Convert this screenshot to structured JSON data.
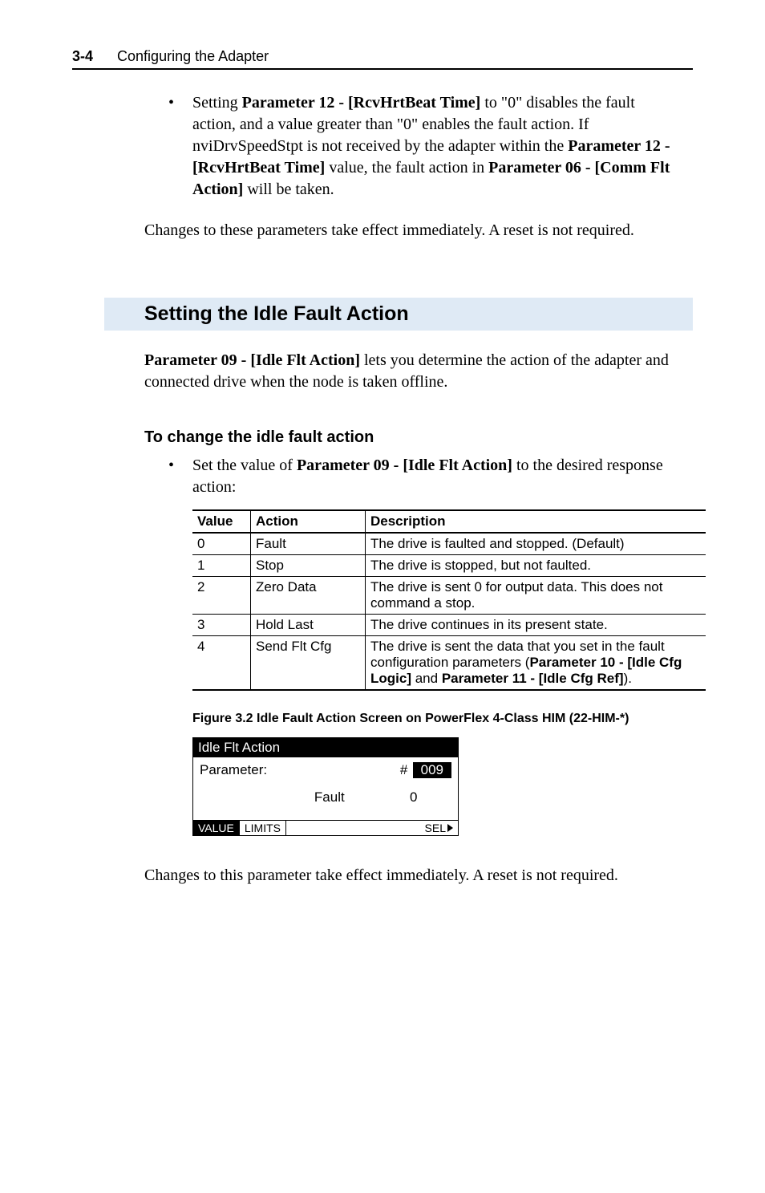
{
  "header": {
    "page": "3-4",
    "title": "Configuring the Adapter"
  },
  "bullet1": {
    "t1": "Setting ",
    "b1": "Parameter 12 - [RcvHrtBeat Time]",
    "t2": " to \"0\" disables the fault action, and a value greater than \"0\" enables the fault action. If nviDrvSpeedStpt is not received by the adapter within the ",
    "b2": "Parameter 12 - [RcvHrtBeat Time]",
    "t3": " value, the fault action in ",
    "b3": "Parameter 06 - [Comm Flt Action]",
    "t4": " will be taken."
  },
  "para_after_bullet": "Changes to these parameters take effect immediately. A reset is not required.",
  "section_heading": "Setting the Idle Fault Action",
  "section_para": {
    "b1": "Parameter 09 - [Idle Flt Action]",
    "t1": " lets you determine the action of the adapter and connected drive when the node is taken offline."
  },
  "sub_heading": "To change the idle fault action",
  "bullet2": {
    "t1": "Set the value of ",
    "b1": "Parameter 09 - [Idle Flt Action]",
    "t2": " to the desired response action:"
  },
  "table": {
    "headers": {
      "value": "Value",
      "action": "Action",
      "desc": "Description"
    },
    "rows": [
      {
        "value": "0",
        "action": "Fault",
        "desc_plain": "The drive is faulted and stopped. (Default)"
      },
      {
        "value": "1",
        "action": "Stop",
        "desc_plain": "The drive is stopped, but not faulted."
      },
      {
        "value": "2",
        "action": "Zero Data",
        "desc_plain": "The drive is sent 0 for output data. This does not command a stop."
      },
      {
        "value": "3",
        "action": "Hold Last",
        "desc_plain": "The drive continues in its present state."
      },
      {
        "value": "4",
        "action": "Send Flt Cfg",
        "desc_t1": "The drive is sent the data that you set in the fault configuration parameters (",
        "desc_b1": "Parameter 10 - [Idle Cfg Logic]",
        "desc_t2": " and ",
        "desc_b2": "Parameter 11 - [Idle Cfg Ref]",
        "desc_t3": ")."
      }
    ]
  },
  "figure_caption": "Figure 3.2   Idle Fault Action Screen on PowerFlex 4-Class HIM (22-HIM-*)",
  "him": {
    "title": "Idle Flt Action",
    "param_label": "Parameter:",
    "hash": "#",
    "num": "009",
    "fault": "Fault",
    "zero": "0",
    "btn_value": "VALUE",
    "btn_limits": "LIMITS",
    "sel": "SEL"
  },
  "closing_para": "Changes to this parameter take effect immediately. A reset is not required."
}
